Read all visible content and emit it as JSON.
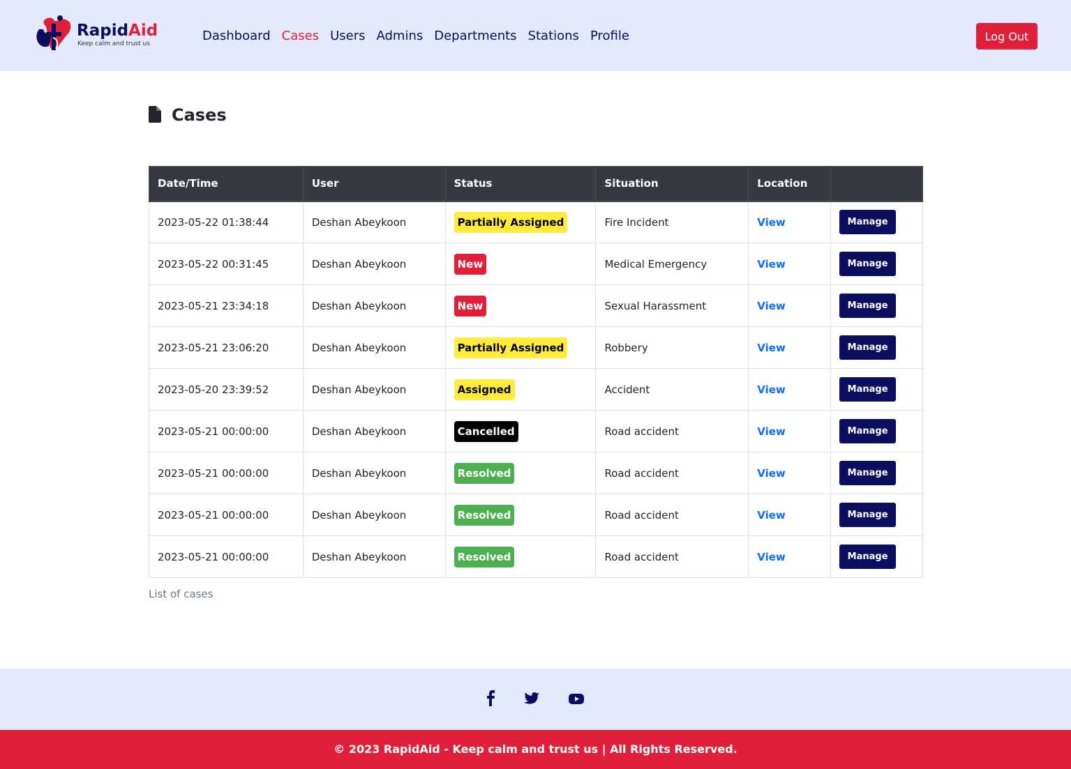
{
  "brand": {
    "name_part1": "Rapid",
    "name_part2": "Aid",
    "tagline": "Keep calm and trust us"
  },
  "nav": [
    {
      "label": "Dashboard",
      "active": false
    },
    {
      "label": "Cases",
      "active": true
    },
    {
      "label": "Users",
      "active": false
    },
    {
      "label": "Admins",
      "active": false
    },
    {
      "label": "Departments",
      "active": false
    },
    {
      "label": "Stations",
      "active": false
    },
    {
      "label": "Profile",
      "active": false
    }
  ],
  "header": {
    "logout_label": "Log Out"
  },
  "page": {
    "title": "Cases",
    "icon": "file-icon"
  },
  "table": {
    "columns": [
      "Date/Time",
      "User",
      "Status",
      "Situation",
      "Location",
      ""
    ],
    "rows": [
      {
        "datetime": "2023-05-22 01:38:44",
        "user": "Deshan Abeykoon",
        "status": "Partially Assigned",
        "situation": "Fire Incident",
        "location": "View",
        "action": "Manage"
      },
      {
        "datetime": "2023-05-22 00:31:45",
        "user": "Deshan Abeykoon",
        "status": "New",
        "situation": "Medical Emergency",
        "location": "View",
        "action": "Manage"
      },
      {
        "datetime": "2023-05-21 23:34:18",
        "user": "Deshan Abeykoon",
        "status": "New",
        "situation": "Sexual Harassment",
        "location": "View",
        "action": "Manage"
      },
      {
        "datetime": "2023-05-21 23:06:20",
        "user": "Deshan Abeykoon",
        "status": "Partially Assigned",
        "situation": "Robbery",
        "location": "View",
        "action": "Manage"
      },
      {
        "datetime": "2023-05-20 23:39:52",
        "user": "Deshan Abeykoon",
        "status": "Assigned",
        "situation": "Accident",
        "location": "View",
        "action": "Manage"
      },
      {
        "datetime": "2023-05-21 00:00:00",
        "user": "Deshan Abeykoon",
        "status": "Cancelled",
        "situation": "Road accident",
        "location": "View",
        "action": "Manage"
      },
      {
        "datetime": "2023-05-21 00:00:00",
        "user": "Deshan Abeykoon",
        "status": "Resolved",
        "situation": "Road accident",
        "location": "View",
        "action": "Manage"
      },
      {
        "datetime": "2023-05-21 00:00:00",
        "user": "Deshan Abeykoon",
        "status": "Resolved",
        "situation": "Road accident",
        "location": "View",
        "action": "Manage"
      },
      {
        "datetime": "2023-05-21 00:00:00",
        "user": "Deshan Abeykoon",
        "status": "Resolved",
        "situation": "Road accident",
        "location": "View",
        "action": "Manage"
      }
    ],
    "caption": "List of cases"
  },
  "status_colors": {
    "Partially Assigned": {
      "bg": "#ffeb3b",
      "fg": "#000000"
    },
    "Assigned": {
      "bg": "#ffeb3b",
      "fg": "#000000"
    },
    "New": {
      "bg": "#e0203a",
      "fg": "#ffffff"
    },
    "Cancelled": {
      "bg": "#000000",
      "fg": "#ffffff"
    },
    "Resolved": {
      "bg": "#4caf50",
      "fg": "#ffffff"
    }
  },
  "colors": {
    "navy": "#0b0d5e",
    "accent_red": "#e0203a",
    "header_bg": "#e2eafb",
    "table_head": "#343a40",
    "link_blue": "#0d6efd"
  },
  "footer": {
    "social": [
      "facebook-icon",
      "twitter-icon",
      "youtube-icon"
    ],
    "copyright": "© 2023 RapidAid - Keep calm and trust us | All Rights Reserved."
  }
}
